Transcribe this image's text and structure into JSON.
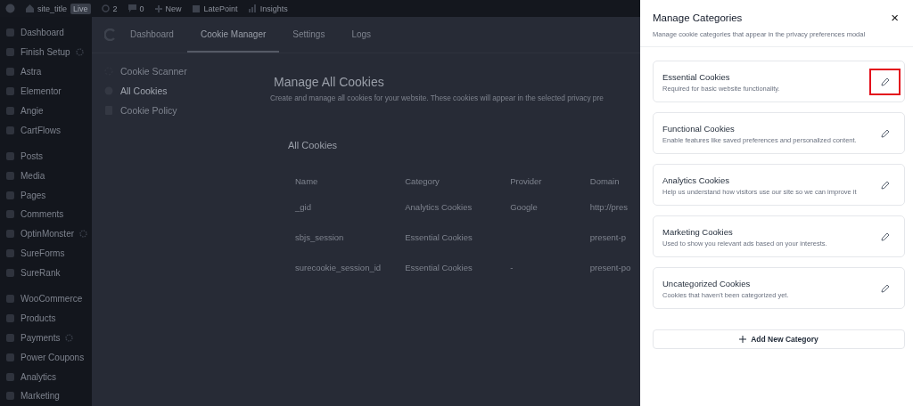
{
  "admin_bar": {
    "site_title": "site_title",
    "live_badge": "Live",
    "updates": "2",
    "comments": "0",
    "new_label": "New",
    "items": [
      "LatePoint",
      "Insights"
    ]
  },
  "sidebar": {
    "items": [
      {
        "label": "Dashboard",
        "badge": false,
        "separator_before": false
      },
      {
        "label": "Finish Setup",
        "badge": true,
        "separator_before": false
      },
      {
        "label": "Astra",
        "badge": false,
        "separator_before": false
      },
      {
        "label": "Elementor",
        "badge": false,
        "separator_before": false
      },
      {
        "label": "Angie",
        "badge": false,
        "separator_before": false
      },
      {
        "label": "CartFlows",
        "badge": false,
        "separator_before": false
      },
      {
        "label": "Posts",
        "badge": false,
        "separator_before": true
      },
      {
        "label": "Media",
        "badge": false,
        "separator_before": false
      },
      {
        "label": "Pages",
        "badge": false,
        "separator_before": false
      },
      {
        "label": "Comments",
        "badge": false,
        "separator_before": false
      },
      {
        "label": "OptinMonster",
        "badge": true,
        "separator_before": false
      },
      {
        "label": "SureForms",
        "badge": false,
        "separator_before": false
      },
      {
        "label": "SureRank",
        "badge": false,
        "separator_before": false
      },
      {
        "label": "WooCommerce",
        "badge": false,
        "separator_before": true
      },
      {
        "label": "Products",
        "badge": false,
        "separator_before": false
      },
      {
        "label": "Payments",
        "badge": true,
        "separator_before": false
      },
      {
        "label": "Power Coupons",
        "badge": false,
        "separator_before": false
      },
      {
        "label": "Analytics",
        "badge": false,
        "separator_before": false
      },
      {
        "label": "Marketing",
        "badge": false,
        "separator_before": false
      }
    ]
  },
  "plugin": {
    "tabs": [
      {
        "label": "Dashboard",
        "selected": false
      },
      {
        "label": "Cookie Manager",
        "selected": true
      },
      {
        "label": "Settings",
        "selected": false
      },
      {
        "label": "Logs",
        "selected": false
      }
    ],
    "nav": [
      {
        "label": "Cookie Scanner",
        "selected": false
      },
      {
        "label": "All Cookies",
        "selected": true
      },
      {
        "label": "Cookie Policy",
        "selected": false
      }
    ],
    "title": "Manage All Cookies",
    "description": "Create and manage all cookies for your website. These cookies will appear in the selected privacy pre",
    "table": {
      "title": "All Cookies",
      "columns": [
        "Name",
        "Category",
        "Provider",
        "Domain"
      ],
      "rows": [
        {
          "name": "_gid",
          "category": "Analytics Cookies",
          "provider": "Google",
          "domain": "http://pres"
        },
        {
          "name": "sbjs_session",
          "category": "Essential Cookies",
          "domain": "present-p"
        },
        {
          "name": "surecookie_session_id",
          "category": "Essential Cookies",
          "provider": "-",
          "domain": "present-po"
        }
      ]
    }
  },
  "panel": {
    "title": "Manage Categories",
    "close": "×",
    "subtitle": "Manage cookie categories that appear in the privacy preferences modal",
    "categories": [
      {
        "name": "Essential Cookies",
        "description": "Required for basic website functionality.",
        "highlighted": true
      },
      {
        "name": "Functional Cookies",
        "description": "Enable features like saved preferences and personalized content.",
        "highlighted": false
      },
      {
        "name": "Analytics Cookies",
        "description": "Help us understand how visitors use our site so we can improve it",
        "highlighted": false
      },
      {
        "name": "Marketing Cookies",
        "description": "Used to show you relevant ads based on your interests.",
        "highlighted": false
      },
      {
        "name": "Uncategorized Cookies",
        "description": "Cookies that haven't been categorized yet.",
        "highlighted": false
      }
    ],
    "add_button": "Add New Category"
  }
}
